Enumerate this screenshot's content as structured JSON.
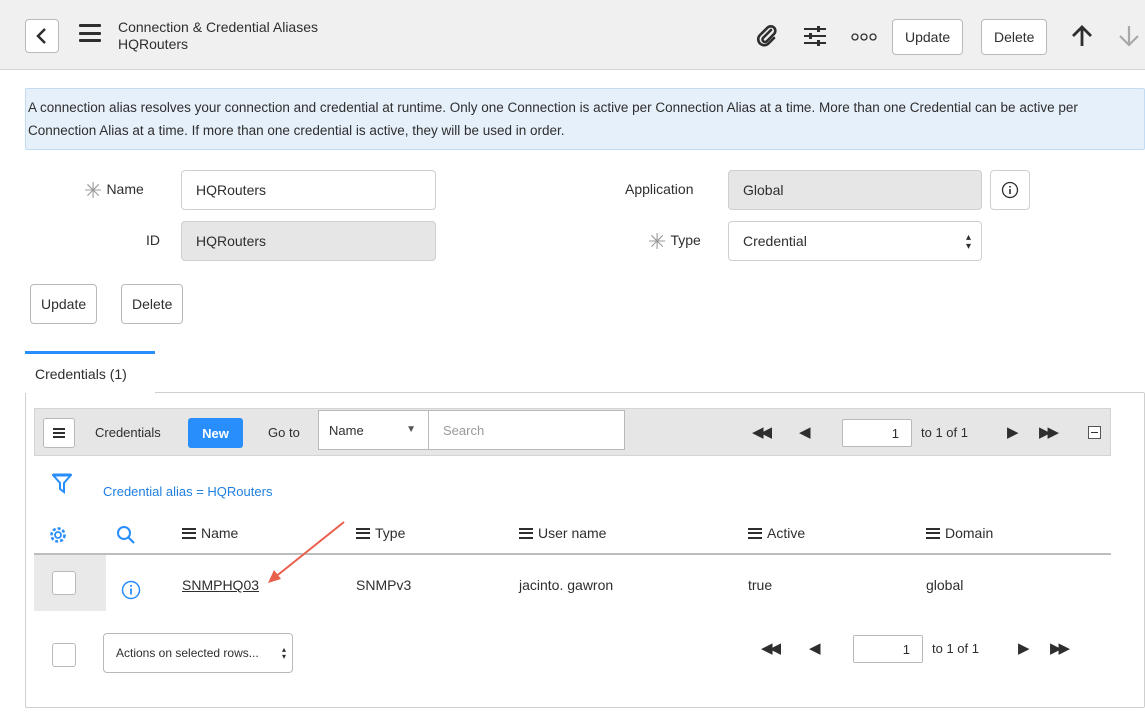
{
  "header": {
    "title": "Connection & Credential Aliases",
    "subtitle": "HQRouters",
    "update_label": "Update",
    "delete_label": "Delete"
  },
  "info_message": "A connection alias resolves your connection and credential at runtime. Only one Connection is active per Connection Alias at a time. More than one Credential can be active per Connection Alias at a time. If more than one credential is active, they will be used in order.",
  "form": {
    "name_label": "Name",
    "name_value": "HQRouters",
    "id_label": "ID",
    "id_value": "HQRouters",
    "application_label": "Application",
    "application_value": "Global",
    "type_label": "Type",
    "type_value": "Credential",
    "update_label": "Update",
    "delete_label": "Delete"
  },
  "tab": {
    "label": "Credentials (1)"
  },
  "list": {
    "title": "Credentials",
    "new_label": "New",
    "goto_label": "Go to",
    "search_field": "Name",
    "search_placeholder": "Search",
    "page_value": "1",
    "page_range": "to 1 of 1",
    "filter": "Credential alias = HQRouters",
    "columns": [
      "Name",
      "Type",
      "User name",
      "Active",
      "Domain"
    ],
    "rows": [
      {
        "name": "SNMPHQ03",
        "type": "SNMPv3",
        "user_name": "jacinto. gawron",
        "active": "true",
        "domain": "global"
      }
    ],
    "actions_label": "Actions on selected rows...",
    "footer_page_value": "1",
    "footer_page_range": "to 1 of 1"
  },
  "colors": {
    "accent": "#278efc",
    "info_bg": "#e6f0fa",
    "link": "#1f7fe0",
    "annotation_arrow": "#e8604c"
  }
}
